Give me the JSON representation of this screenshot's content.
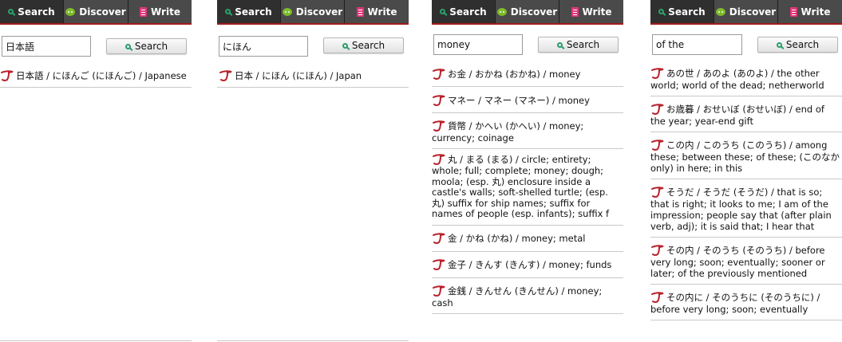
{
  "tabs": [
    {
      "label": "Search",
      "icon": "search-icon"
    },
    {
      "label": "Discover",
      "icon": "discover-icon"
    },
    {
      "label": "Write",
      "icon": "write-icon"
    }
  ],
  "search_button_label": "Search",
  "accent_color": "#a11b1b",
  "panels": [
    {
      "query": "日本語",
      "results": [
        {
          "text": "日本語 / にほんご (にほんご) / Japanese"
        }
      ]
    },
    {
      "query": "にほん",
      "results": [
        {
          "text": "日本 / にほん (にほん) / Japan"
        }
      ]
    },
    {
      "query": "money",
      "results": [
        {
          "text": "お金 / おかね (おかね) / money"
        },
        {
          "text": "マネー / マネー (マネー) / money"
        },
        {
          "text": "貨幣 / かへい (かへい) / money; currency; coinage"
        },
        {
          "text": "丸 / まる (まる) / circle; entirety; whole; full; complete; money; dough; moola; (esp. 丸) enclosure inside a castle's walls; soft-shelled turtle; (esp. 丸) suffix for ship names; suffix for names of people (esp. infants); suffix f"
        },
        {
          "text": "金 / かね (かね) / money; metal"
        },
        {
          "text": "金子 / きんす (きんす) / money; funds"
        },
        {
          "text": "金銭 / きんせん (きんせん) / money; cash"
        }
      ]
    },
    {
      "query": "of the",
      "results": [
        {
          "text": "あの世 / あのよ (あのよ) / the other world; world of the dead; netherworld"
        },
        {
          "text": "お歳暮 / おせいぼ (おせいぼ) / end of the year; year-end gift"
        },
        {
          "text": "この内 / このうち (このうち) / among these; between these; of these; (このなか only) in here; in this"
        },
        {
          "text": "そうだ / そうだ (そうだ) / that is so; that is right; it looks to me; I am of the impression; people say that (after plain verb, adj); it is said that; I hear that"
        },
        {
          "text": "その内 / そのうち (そのうち) / before very long; soon; eventually; sooner or later; of the previously mentioned"
        },
        {
          "text": "その内に / そのうちに (そのうちに) / before very long; soon; eventually"
        }
      ]
    }
  ]
}
